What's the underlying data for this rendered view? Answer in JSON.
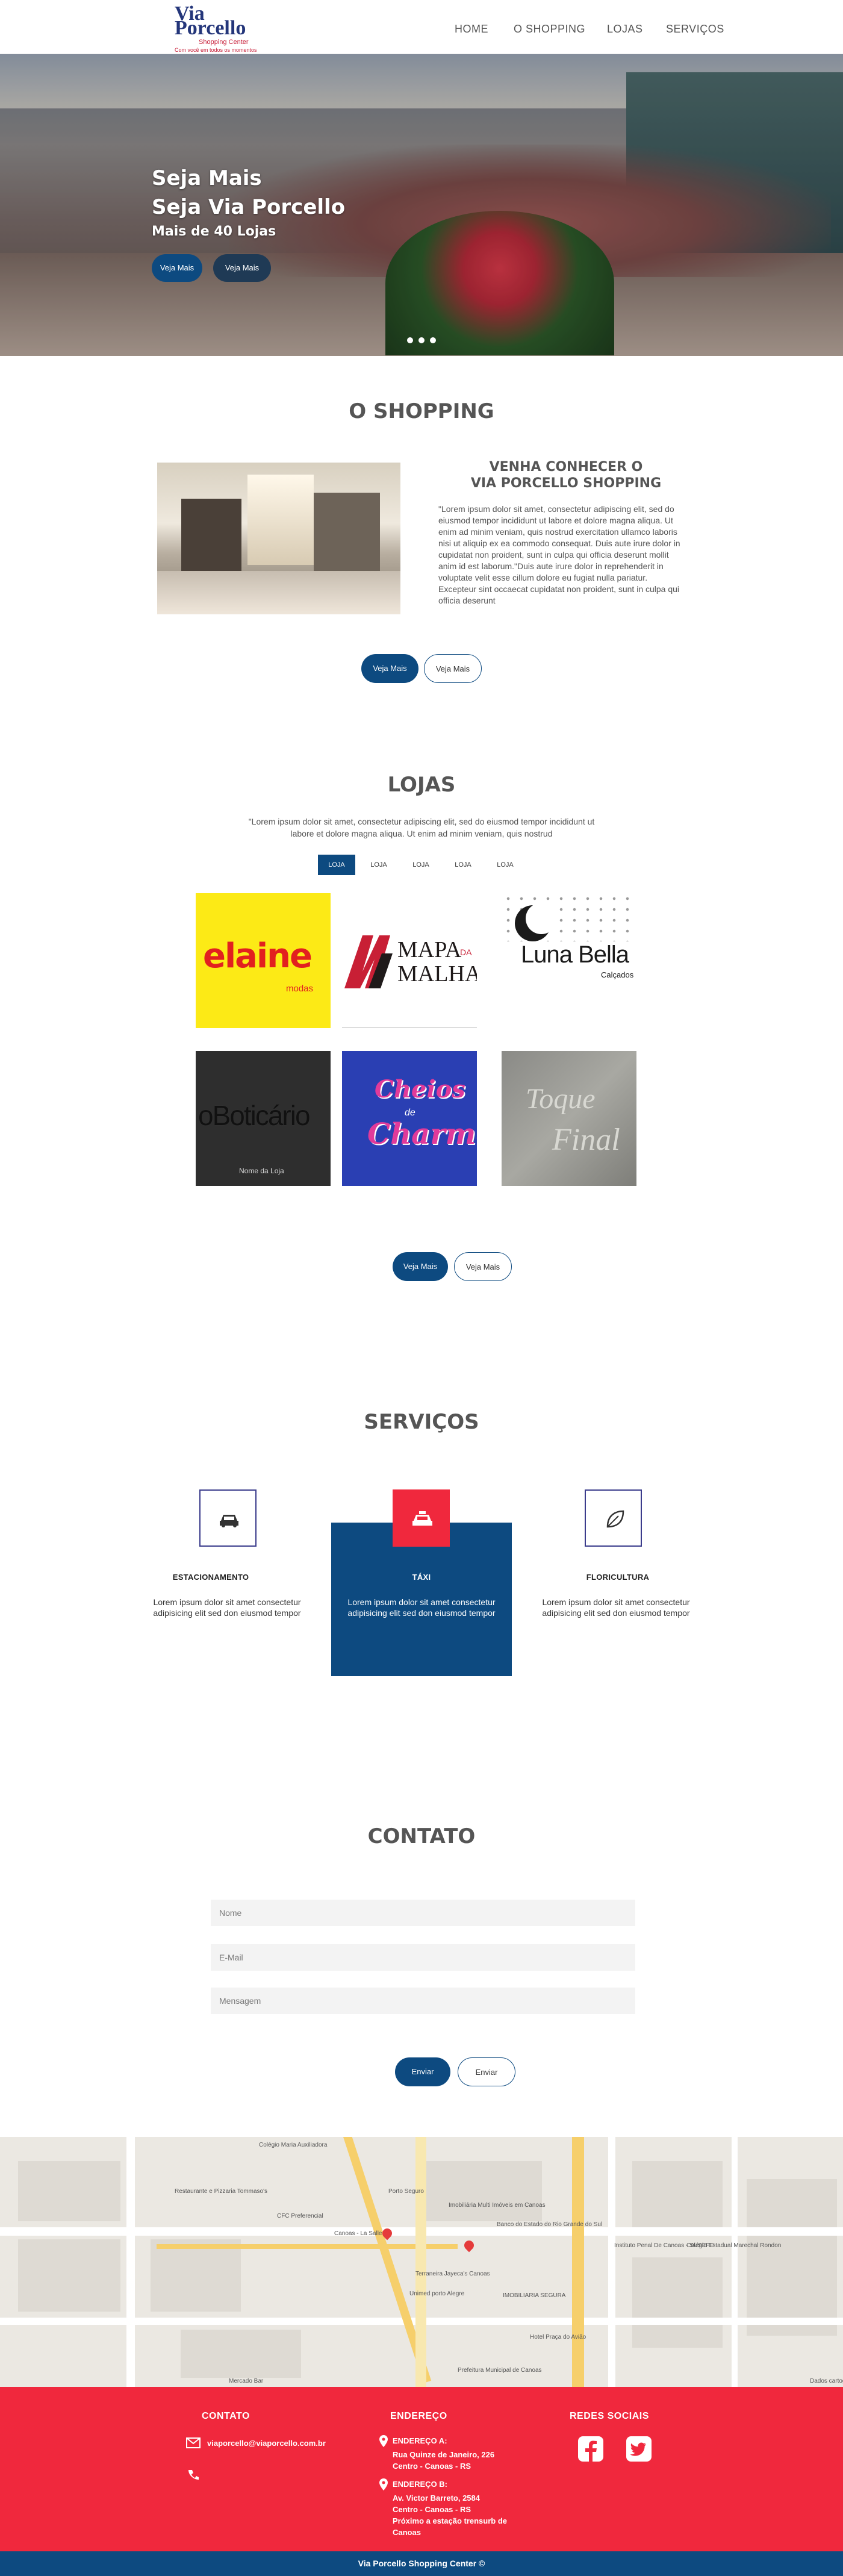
{
  "header": {
    "logo": {
      "line1": "Via",
      "line2": "Porcello",
      "sub": "Shopping Center",
      "tagline": "Com você em todos os momentos"
    },
    "nav": [
      "HOME",
      "O SHOPPING",
      "LOJAS",
      "SERVIÇOS"
    ]
  },
  "hero": {
    "title1": "Seja Mais",
    "title2": "Seja Via Porcello",
    "subtitle": "Mais de 40 Lojas",
    "btn1": "Veja Mais",
    "btn2": "Veja Mais"
  },
  "shopping": {
    "title": "O SHOPPING",
    "heading1": "VENHA CONHECER O",
    "heading2": "VIA PORCELLO SHOPPING",
    "text": "\"Lorem ipsum dolor sit amet, consectetur adipiscing elit, sed do eiusmod tempor incididunt ut labore et dolore magna aliqua. Ut enim ad minim veniam, quis nostrud exercitation ullamco laboris nisi ut aliquip ex ea commodo consequat. Duis aute irure dolor in cupidatat non proident, sunt in culpa qui officia deserunt mollit anim id est laborum.\"Duis aute irure dolor in reprehenderit in voluptate velit esse cillum dolore eu fugiat nulla pariatur. Excepteur sint occaecat cupidatat non proident, sunt in culpa qui officia deserunt",
    "btn1": "Veja Mais",
    "btn2": "Veja Mais"
  },
  "lojas": {
    "title": "LOJAS",
    "text": "\"Lorem ipsum dolor sit amet, consectetur adipiscing elit, sed do eiusmod tempor incididunt ut labore et dolore magna aliqua. Ut enim ad minim veniam, quis nostrud",
    "tabs": [
      "LOJA",
      "LOJA",
      "LOJA",
      "LOJA",
      "LOJA"
    ],
    "stores": [
      {
        "logo": "elaine",
        "sub": "modas"
      },
      {
        "logo": "MAPA",
        "logo2": "MALHA",
        "small": "DA"
      },
      {
        "logo": "Luna Bella",
        "sub": "Calçados"
      },
      {
        "logo": "oBoticário",
        "caption": "Nome da Loja"
      },
      {
        "logo": "Cheios",
        "logo2": "Charme",
        "small": "de"
      },
      {
        "logo": "Toque",
        "logo2": "Final"
      }
    ],
    "btn1": "Veja Mais",
    "btn2": "Veja Mais"
  },
  "servicos": {
    "title": "SERVIÇOS",
    "items": [
      {
        "name": "ESTACIONAMENTO",
        "desc": "Lorem ipsum dolor sit amet consectetur adipisicing elit sed don eiusmod tempor",
        "icon": "car-icon"
      },
      {
        "name": "TÁXI",
        "desc": "Lorem ipsum dolor sit amet consectetur adipisicing elit sed don eiusmod tempor",
        "icon": "taxi-icon"
      },
      {
        "name": "FLORICULTURA",
        "desc": "Lorem ipsum dolor sit amet consectetur adipisicing elit sed don eiusmod tempor",
        "icon": "leaf-icon"
      }
    ],
    "accent": "#0d4a80",
    "taxi_icon_bg": "#f0283d"
  },
  "contato": {
    "title": "CONTATO",
    "name_placeholder": "Nome",
    "email_placeholder": "E-Mail",
    "message_placeholder": "Mensagem",
    "send": "Enviar",
    "send2": "Enviar"
  },
  "map": {
    "labels": [
      "Colégio Maria Auxiliadora",
      "Restaurante e Pizzaria Tommaso's",
      "CFC Preferencial",
      "Canoas - La Salle",
      "Porto Seguro",
      "Imobiliária Multi Imóveis em Canoas",
      "Banco do Estado do Rio Grande do Sul",
      "Instituto Penal De Canoas - SUSEPE",
      "Colégio Estadual Marechal Rondon",
      "Terraneira Jayeca's Canoas",
      "Unimed porto Alegre",
      "IMOBILIARIA SEGURA",
      "Hotel Praça do Avião",
      "Prefeitura Municipal de Canoas",
      "Mercado Bar",
      "Dados cartog"
    ]
  },
  "footer": {
    "contato_title": "CONTATO",
    "email": "viaporcello@viaporcello.com.br",
    "endereco_title": "ENDEREÇO",
    "addr_a_title": "ENDEREÇO A:",
    "addr_a_1": "Rua Quinze de Janeiro, 226",
    "addr_a_2": "Centro - Canoas - RS",
    "addr_b_title": "ENDEREÇO B:",
    "addr_b_1": "Av. Victor Barreto, 2584",
    "addr_b_2": "Centro - Canoas - RS",
    "addr_b_3": "Próximo a estação trensurb de",
    "addr_b_4": "Canoas",
    "redes_title": "REDES SOCIAIS",
    "copyright": "Via Porcello Shopping Center ©"
  }
}
